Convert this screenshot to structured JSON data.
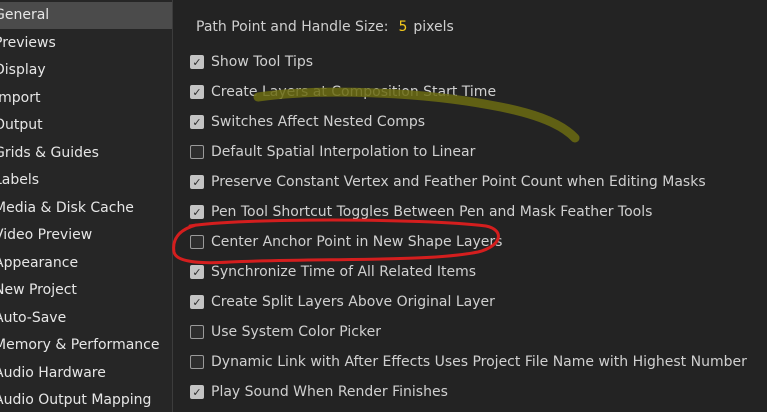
{
  "sidebar": {
    "items": [
      {
        "label": "General",
        "selected": true
      },
      {
        "label": "Previews"
      },
      {
        "label": "Display"
      },
      {
        "label": "Import"
      },
      {
        "label": "Output"
      },
      {
        "label": "Grids & Guides"
      },
      {
        "label": "Labels"
      },
      {
        "label": "Media & Disk Cache"
      },
      {
        "label": "Video Preview"
      },
      {
        "label": "Appearance"
      },
      {
        "label": "New Project"
      },
      {
        "label": "Auto-Save"
      },
      {
        "label": "Memory & Performance"
      },
      {
        "label": "Audio Hardware"
      },
      {
        "label": "Audio Output Mapping"
      }
    ]
  },
  "general": {
    "size_label": "Path Point and Handle Size:",
    "size_value": "5",
    "size_unit": "pixels",
    "options": [
      {
        "label": "Show Tool Tips",
        "checked": true
      },
      {
        "label": "Create Layers at Composition Start Time",
        "checked": true
      },
      {
        "label": "Switches Affect Nested Comps",
        "checked": true
      },
      {
        "label": "Default Spatial Interpolation to Linear",
        "checked": false
      },
      {
        "label": "Preserve Constant Vertex and Feather Point Count when Editing Masks",
        "checked": true
      },
      {
        "label": "Pen Tool Shortcut Toggles Between Pen and Mask Feather Tools",
        "checked": true
      },
      {
        "label": "Center Anchor Point in New Shape Layers",
        "checked": false
      },
      {
        "label": "Synchronize Time of All Related Items",
        "checked": true
      },
      {
        "label": "Create Split Layers Above Original Layer",
        "checked": true
      },
      {
        "label": "Use System Color Picker",
        "checked": false
      },
      {
        "label": "Dynamic Link with After Effects Uses Project File Name with Highest Number",
        "checked": false
      },
      {
        "label": "Play Sound When Render Finishes",
        "checked": true
      }
    ]
  },
  "colors": {
    "value_accent": "#f2c81c",
    "annotation_circle": "#d41e1e",
    "annotation_stroke": "#6b6b12"
  },
  "icons": {
    "checkbox_checked": "check-icon"
  }
}
